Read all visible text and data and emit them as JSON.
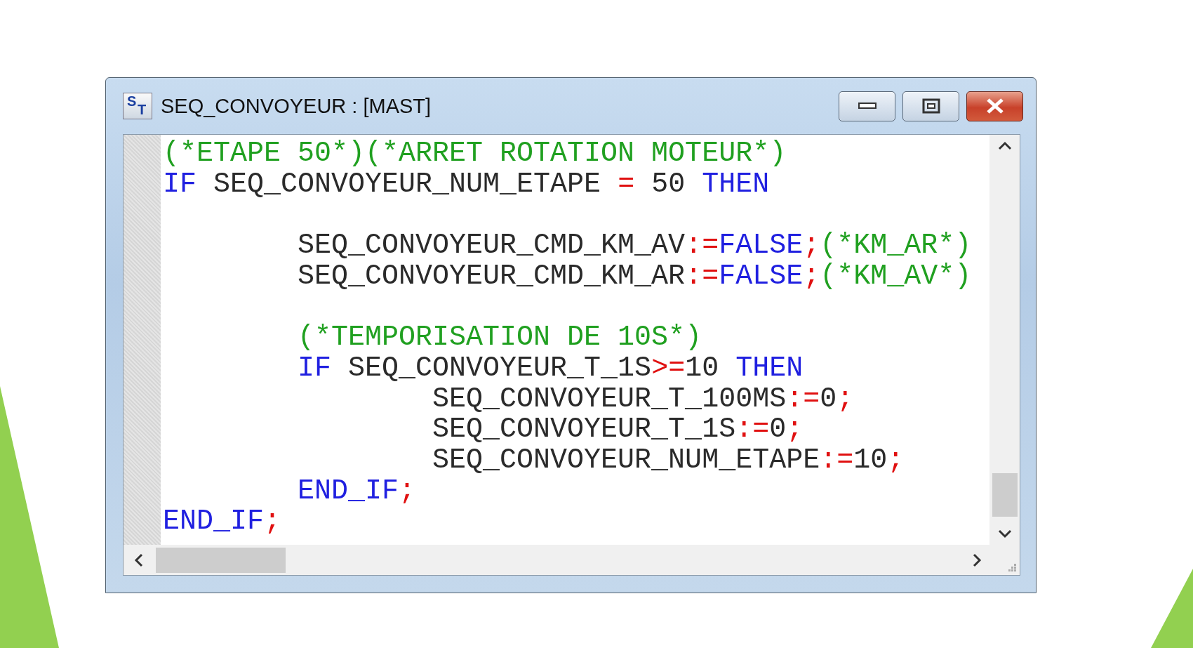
{
  "window": {
    "title": "SEQ_CONVOYEUR : [MAST]",
    "icon_letters": [
      "S",
      "T"
    ]
  },
  "code": [
    {
      "blank_before": false,
      "tokens": [
        {
          "kind": "comment",
          "text": "(*ETAPE 50*)(*ARRET ROTATION MOTEUR*)"
        }
      ]
    },
    {
      "blank_before": false,
      "tokens": [
        {
          "kind": "keyword",
          "text": "IF"
        },
        {
          "kind": "ident",
          "text": " SEQ_CONVOYEUR_NUM_ETAPE "
        },
        {
          "kind": "op",
          "text": "="
        },
        {
          "kind": "ident",
          "text": " 50 "
        },
        {
          "kind": "keyword",
          "text": "THEN"
        }
      ]
    },
    {
      "blank_before": true,
      "tokens": [
        {
          "kind": "ident",
          "text": "        SEQ_CONVOYEUR_CMD_KM_AV"
        },
        {
          "kind": "op",
          "text": ":="
        },
        {
          "kind": "keyword",
          "text": "FALSE"
        },
        {
          "kind": "op",
          "text": ";"
        },
        {
          "kind": "comment",
          "text": "(*KM_AR*)"
        }
      ]
    },
    {
      "blank_before": false,
      "tokens": [
        {
          "kind": "ident",
          "text": "        SEQ_CONVOYEUR_CMD_KM_AR"
        },
        {
          "kind": "op",
          "text": ":="
        },
        {
          "kind": "keyword",
          "text": "FALSE"
        },
        {
          "kind": "op",
          "text": ";"
        },
        {
          "kind": "comment",
          "text": "(*KM_AV*)"
        }
      ]
    },
    {
      "blank_before": true,
      "tokens": [
        {
          "kind": "comment",
          "text": "        (*TEMPORISATION DE 10S*)"
        }
      ]
    },
    {
      "blank_before": false,
      "tokens": [
        {
          "kind": "keyword",
          "text": "        IF"
        },
        {
          "kind": "ident",
          "text": " SEQ_CONVOYEUR_T_1S"
        },
        {
          "kind": "op",
          "text": ">="
        },
        {
          "kind": "ident",
          "text": "10 "
        },
        {
          "kind": "keyword",
          "text": "THEN"
        }
      ]
    },
    {
      "blank_before": false,
      "tokens": [
        {
          "kind": "ident",
          "text": "                SEQ_CONVOYEUR_T_100MS"
        },
        {
          "kind": "op",
          "text": ":="
        },
        {
          "kind": "ident",
          "text": "0"
        },
        {
          "kind": "op",
          "text": ";"
        }
      ]
    },
    {
      "blank_before": false,
      "tokens": [
        {
          "kind": "ident",
          "text": "                SEQ_CONVOYEUR_T_1S"
        },
        {
          "kind": "op",
          "text": ":="
        },
        {
          "kind": "ident",
          "text": "0"
        },
        {
          "kind": "op",
          "text": ";"
        }
      ]
    },
    {
      "blank_before": false,
      "tokens": [
        {
          "kind": "ident",
          "text": "                SEQ_CONVOYEUR_NUM_ETAPE"
        },
        {
          "kind": "op",
          "text": ":="
        },
        {
          "kind": "ident",
          "text": "10"
        },
        {
          "kind": "op",
          "text": ";"
        }
      ]
    },
    {
      "blank_before": false,
      "tokens": [
        {
          "kind": "keyword",
          "text": "        END_IF"
        },
        {
          "kind": "op",
          "text": ";"
        }
      ]
    },
    {
      "blank_before": false,
      "tokens": [
        {
          "kind": "keyword",
          "text": "END_IF"
        },
        {
          "kind": "op",
          "text": ";"
        }
      ]
    }
  ]
}
